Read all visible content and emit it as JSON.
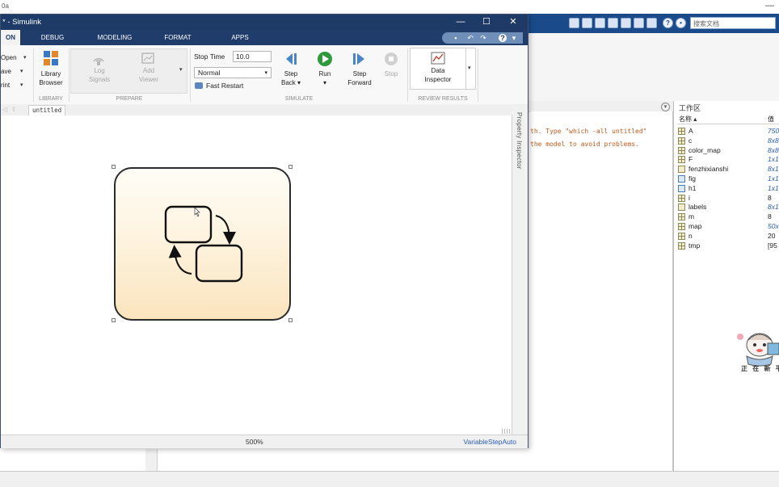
{
  "matlab": {
    "title_fragment": "0a",
    "search_placeholder": "搜索文档",
    "command_window": {
      "lines": [
        "th. Type \"which -all untitled\"",
        "the model to avoid problems."
      ]
    },
    "workspace": {
      "title": "工作区",
      "col_name": "名称 ▴",
      "col_value": "值",
      "variables": [
        {
          "name": "A",
          "value": "750",
          "icon": "matrix-icon",
          "style": "link"
        },
        {
          "name": "c",
          "value": "8x8",
          "icon": "matrix-icon",
          "style": "link"
        },
        {
          "name": "color_map",
          "value": "8x8",
          "icon": "matrix-icon",
          "style": "link"
        },
        {
          "name": "F",
          "value": "1x1",
          "icon": "matrix-icon",
          "style": "link"
        },
        {
          "name": "fenzhixianshi",
          "value": "8x1",
          "icon": "cell-icon",
          "style": "link"
        },
        {
          "name": "fig",
          "value": "1x1",
          "icon": "figure-icon",
          "style": "link"
        },
        {
          "name": "h1",
          "value": "1x1",
          "icon": "figure-icon",
          "style": "link"
        },
        {
          "name": "i",
          "value": "8",
          "icon": "matrix-icon",
          "style": "plain"
        },
        {
          "name": "labels",
          "value": "8x1",
          "icon": "cell-icon",
          "style": "link"
        },
        {
          "name": "m",
          "value": "8",
          "icon": "matrix-icon",
          "style": "plain"
        },
        {
          "name": "map",
          "value": "50x",
          "icon": "matrix-icon",
          "style": "link"
        },
        {
          "name": "n",
          "value": "20",
          "icon": "matrix-icon",
          "style": "plain"
        },
        {
          "name": "tmp",
          "value": "[95",
          "icon": "matrix-icon",
          "style": "plain"
        }
      ]
    },
    "mascot_text": "正 在 新 平"
  },
  "simulink": {
    "title": "* - Simulink",
    "window_controls": {
      "minimize": "—",
      "maximize": "☐",
      "close": "✕"
    },
    "tabs": [
      {
        "label": "ON",
        "active": true
      },
      {
        "label": "DEBUG",
        "active": false
      },
      {
        "label": "MODELING",
        "active": false
      },
      {
        "label": "FORMAT",
        "active": false
      },
      {
        "label": "APPS",
        "active": false
      }
    ],
    "file_group": {
      "open": "Open",
      "save": "ave",
      "print": "rint"
    },
    "library": {
      "label_line1": "Library",
      "label_line2": "Browser",
      "group": "LIBRARY"
    },
    "prepare": {
      "log_signals_1": "Log",
      "log_signals_2": "Signals",
      "add_viewer_1": "Add",
      "add_viewer_2": "Viewer",
      "group": "PREPARE"
    },
    "simulate": {
      "stop_time_label": "Stop Time",
      "stop_time_value": "10.0",
      "mode": "Normal",
      "fast_restart": "Fast Restart",
      "step_back_1": "Step",
      "step_back_2": "Back ▾",
      "run": "Run",
      "step_forward_1": "Step",
      "step_forward_2": "Forward",
      "stop": "Stop",
      "group": "SIMULATE"
    },
    "review": {
      "data_inspector_1": "Data",
      "data_inspector_2": "Inspector",
      "group": "REVIEW RESULTS"
    },
    "breadcrumb": "untitled",
    "property_inspector": "Property Inspector",
    "zoom": "500%",
    "solver": "VariableStepAuto",
    "accent": "#1e3a66"
  }
}
